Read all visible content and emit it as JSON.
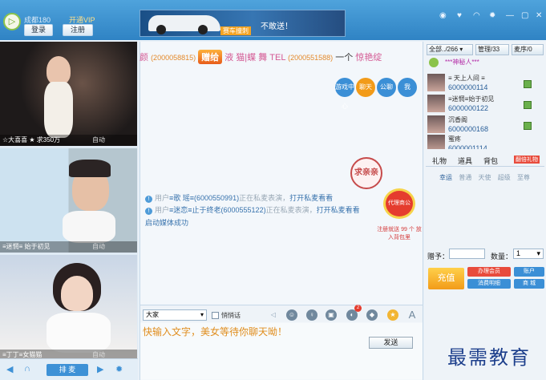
{
  "header": {
    "username": "成都180",
    "vip_link": "开通VIP",
    "login_button": "登录",
    "register_button": "注册",
    "banner_tag": "赛车撞刺",
    "banner_text": "不敢送！",
    "window_icons": [
      "eye-icon",
      "heart-icon",
      "wifi-icon",
      "gear-icon",
      "minimize-icon",
      "maximize-icon",
      "close-icon"
    ]
  },
  "videos": [
    {
      "label": "☆大喜喜 ★ 求350万",
      "mode": "自动"
    },
    {
      "label": "≡迷惘≡ 始于初见",
      "mode": "自动"
    },
    {
      "label": "≡丁丁≡女猫猫",
      "mode": "自动"
    }
  ],
  "left_toolbar": {
    "mic_button": "排 麦"
  },
  "chat": {
    "scroll_message": {
      "prefix": "颜",
      "id1": "(2000058815)",
      "action": "赠给",
      "target": "液 猫|蝶 舞 TEL",
      "id2": "(2000551588)",
      "count": "一个",
      "gift": "惊艳绽"
    },
    "bubbles": [
      "游戏中心",
      "聊天",
      "公聊",
      "我"
    ],
    "stamp": "求亲亲",
    "promo_badge": "代理商公告",
    "promo_caption": "注册就送 99 个 放入背包里",
    "messages": [
      {
        "prefix": "用户",
        "user": "≡歌 瑶≡(6000550991)",
        "text": "正在私麦表演，",
        "link": "打开私麦看看"
      },
      {
        "prefix": "用户",
        "user": "≡迷恋≡止于终老(6000555122)",
        "text": "正在私麦表演，",
        "link": "打开私麦看看"
      },
      {
        "prefix": "",
        "user": "",
        "text": "启动媒体成功",
        "link": ""
      }
    ]
  },
  "input": {
    "target": "大家",
    "quiet_label": "悄悄话",
    "placeholder": "快输入文字，美女等待你聊天呦！",
    "send_button": "发送",
    "tool_badge": "2"
  },
  "right_panel": {
    "tabs": [
      "全部../266",
      "管理/33",
      "麦序/0"
    ],
    "users": [
      {
        "name": "***神秘人***",
        "id": ""
      },
      {
        "name": "≡ 天上人间 ≡",
        "id": "6000000114"
      },
      {
        "name": "≡迷惘≡始于初见",
        "id": "6000000122"
      },
      {
        "name": "沉香阁",
        "id": "6000000168"
      },
      {
        "name": "蜜疼",
        "id": "6000001114"
      }
    ],
    "gift_tabs": [
      "礼物",
      "道具",
      "背包"
    ],
    "gift_badge": "翻倍礼物",
    "gift_sub": [
      "幸运",
      "普通",
      "天使",
      "超级",
      "至尊"
    ],
    "give_to_label": "赠予：",
    "qty_label": "数量：",
    "qty_value": "1",
    "recharge_button": "充值",
    "buttons": [
      "办理会员",
      "账户",
      "消费明细",
      "商 城"
    ]
  },
  "watermark": "最需教育"
}
